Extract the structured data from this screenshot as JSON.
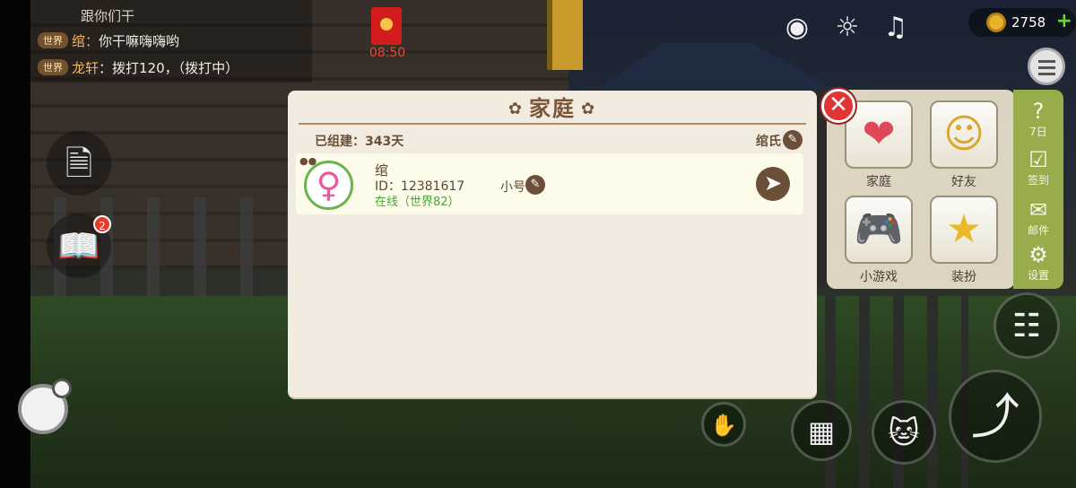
{
  "chat": {
    "lines": [
      {
        "tag": "",
        "name": "",
        "message": "跟你们干"
      },
      {
        "tag": "世界",
        "name": "绾：",
        "message": "你干嘛嗨嗨哟"
      },
      {
        "tag": "世界",
        "name": "龙轩",
        "message": "：拨打120，（拨打中）"
      }
    ]
  },
  "red_envelope": {
    "timer": "08:50"
  },
  "hud": {
    "coins": "2758",
    "icons": [
      "camera-icon",
      "sun-icon",
      "music-icon",
      "plus-icon",
      "list-icon"
    ]
  },
  "left_buttons": {
    "notes_badge": "2"
  },
  "menu": {
    "tiles": [
      {
        "label": "家庭",
        "icon": "heart-icon"
      },
      {
        "label": "好友",
        "icon": "friends-icon"
      },
      {
        "label": "小游戏",
        "icon": "gamepad-icon"
      },
      {
        "label": "装扮",
        "icon": "wand-icon"
      }
    ],
    "side": [
      {
        "label": "7日",
        "icon": "question-icon"
      },
      {
        "label": "签到",
        "icon": "checkin-icon"
      },
      {
        "label": "邮件",
        "icon": "mail-icon"
      },
      {
        "label": "设置",
        "icon": "gear-icon"
      }
    ]
  },
  "dialog": {
    "title": "家庭",
    "founded": "已组建：343天",
    "family_name": "绾氏",
    "member": {
      "name": "绾",
      "id": "ID：12381617",
      "status": "在线（世界82）",
      "role": "小号"
    }
  },
  "colors": {
    "accent_brown": "#6b4f38",
    "online_green": "#4aa63a",
    "close_red": "#e23434",
    "side_strip_green": "#97ad4b"
  }
}
